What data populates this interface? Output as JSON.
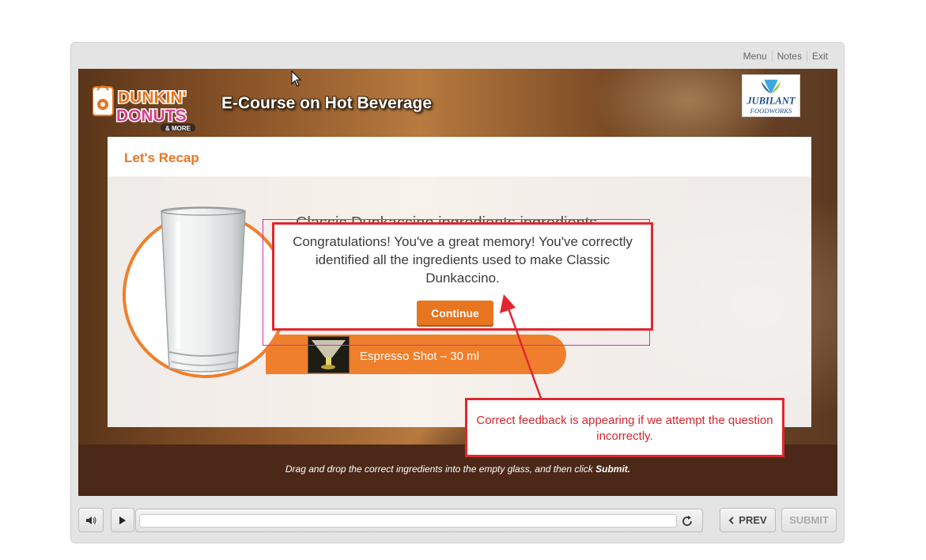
{
  "top_menu": {
    "menu": "Menu",
    "notes": "Notes",
    "exit": "Exit"
  },
  "header": {
    "course_title": "E-Course on Hot Beverage",
    "brand_logo": {
      "line1": "DUNKIN'",
      "line2": "DONUTS",
      "line3": "& MORE"
    },
    "partner_logo": {
      "line1": "JUBILANT",
      "line2": "FOODWORKS"
    }
  },
  "slide": {
    "title": "Let's Recap",
    "question_partial": "Classic Dunkaccino ingredients                              ingredients",
    "ingredient_label": "Espresso Shot – 30 ml"
  },
  "feedback": {
    "message": "Congratulations! You've a great memory! You've correctly identified all the ingredients used to make Classic Dunkaccino.",
    "continue_label": "Continue"
  },
  "annotation": {
    "note": "Correct feedback is appearing if we attempt the question incorrectly.",
    "color": "#e3262e"
  },
  "instruction": {
    "text": "Drag and drop the correct ingredients into the empty glass, and then click ",
    "emphasis": "Submit."
  },
  "controls": {
    "prev_label": "PREV",
    "submit_label": "SUBMIT",
    "icons": [
      "volume-icon",
      "play-icon",
      "replay-icon",
      "chevron-left-icon"
    ]
  },
  "colors": {
    "accent": "#e8751f",
    "bottom_bar": "#4b2818",
    "annotation": "#e3262e"
  }
}
